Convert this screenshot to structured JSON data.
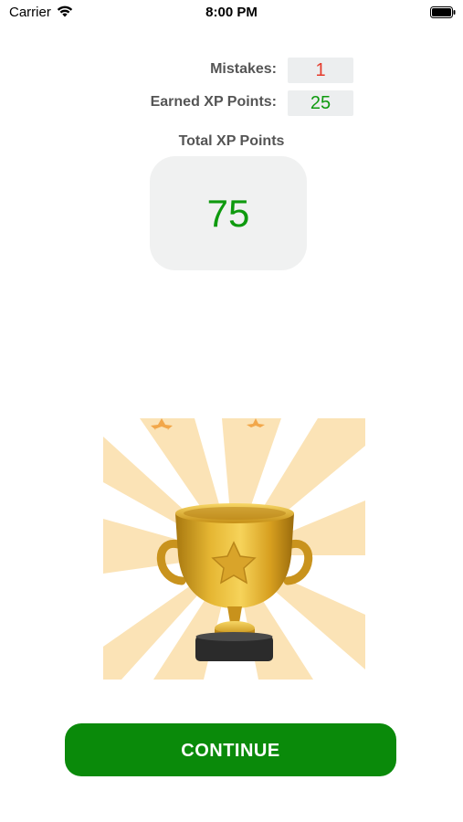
{
  "status_bar": {
    "carrier": "Carrier",
    "time": "8:00 PM",
    "wifi_icon": "wifi-icon",
    "battery_icon": "battery-icon"
  },
  "stats": {
    "mistakes_label": "Mistakes:",
    "mistakes_value": "1",
    "mistakes_color": "#e53b2b",
    "earned_label": "Earned XP Points:",
    "earned_value": "25",
    "earned_color": "#0e9a0e"
  },
  "total": {
    "label": "Total XP Points",
    "value": "75",
    "color": "#0e9a0e"
  },
  "illustration": {
    "icon": "trophy-icon"
  },
  "actions": {
    "continue_label": "CONTINUE",
    "continue_color": "#0a8a0a"
  }
}
